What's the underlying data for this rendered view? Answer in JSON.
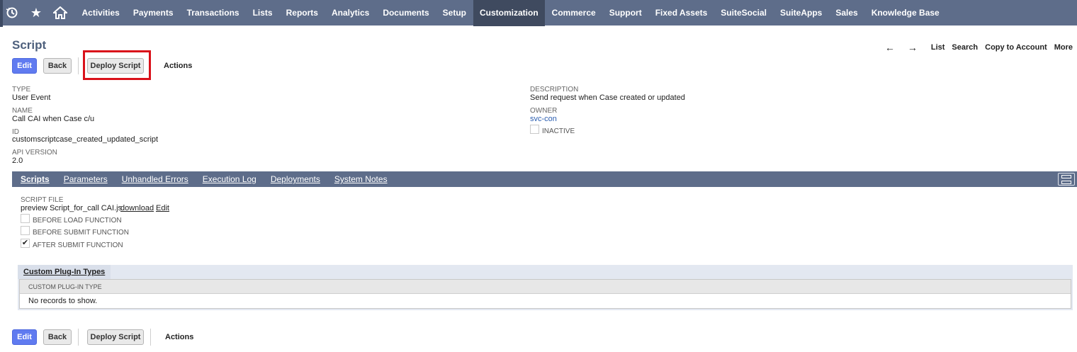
{
  "topnav": {
    "icons": [
      "recent-history-icon",
      "star-icon",
      "home-icon"
    ],
    "items": [
      "Activities",
      "Payments",
      "Transactions",
      "Lists",
      "Reports",
      "Analytics",
      "Documents",
      "Setup",
      "Customization",
      "Commerce",
      "Support",
      "Fixed Assets",
      "SuiteSocial",
      "SuiteApps",
      "Sales",
      "Knowledge Base"
    ],
    "active": "Customization"
  },
  "page": {
    "title": "Script"
  },
  "header_links": {
    "prev_arrow": "←",
    "next_arrow": "→",
    "list": "List",
    "search": "Search",
    "copy_to_account": "Copy to Account",
    "more": "More"
  },
  "toolbar": {
    "edit": "Edit",
    "back": "Back",
    "deploy_script": "Deploy Script",
    "actions": "Actions"
  },
  "fields": {
    "type_label": "TYPE",
    "type_value": "User Event",
    "name_label": "NAME",
    "name_value": "Call CAI when Case c/u",
    "id_label": "ID",
    "id_value": "customscriptcase_created_updated_script",
    "api_label": "API VERSION",
    "api_value": "2.0",
    "description_label": "DESCRIPTION",
    "description_value": "Send request when Case created or updated",
    "owner_label": "OWNER",
    "owner_value": "svc-con",
    "inactive_label": "INACTIVE"
  },
  "subtabs": [
    "Scripts",
    "Parameters",
    "Unhandled Errors",
    "Execution Log",
    "Deployments",
    "System Notes"
  ],
  "script_file": {
    "label": "SCRIPT FILE",
    "value": "preview Script_for_call CAI.js",
    "download": "download",
    "edit": "Edit"
  },
  "functions": [
    {
      "label": "BEFORE LOAD FUNCTION",
      "checked": false
    },
    {
      "label": "BEFORE SUBMIT FUNCTION",
      "checked": false
    },
    {
      "label": "AFTER SUBMIT FUNCTION",
      "checked": true
    }
  ],
  "checkmark": "✔",
  "plugin": {
    "tab": "Custom Plug-In Types",
    "column": "CUSTOM PLUG-IN TYPE",
    "empty": "No records to show."
  }
}
